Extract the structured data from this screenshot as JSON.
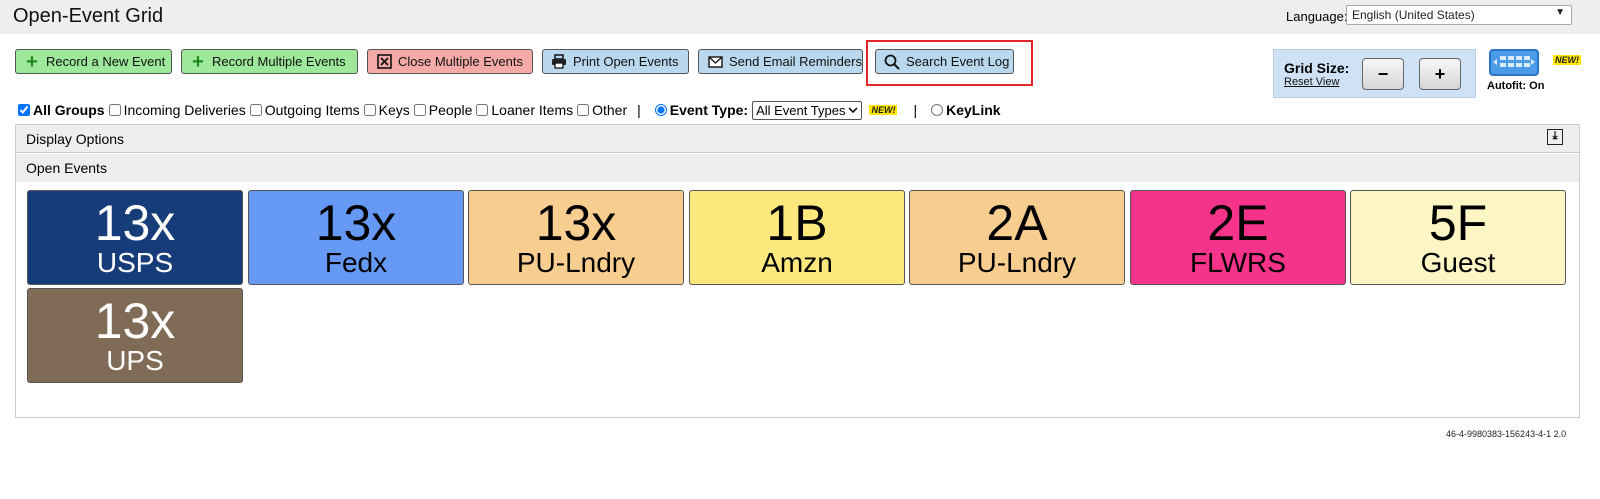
{
  "header": {
    "title": "Open-Event Grid",
    "language_label": "Language:",
    "language_value": "English (United States)"
  },
  "toolbar": {
    "record_new": "Record a New Event",
    "record_multiple": "Record Multiple Events",
    "close_multiple": "Close Multiple Events",
    "print_open": "Print Open Events",
    "send_email": "Send Email Reminders",
    "search_log": "Search Event Log"
  },
  "grid_size": {
    "label": "Grid Size:",
    "reset": "Reset View",
    "minus": "−",
    "plus": "+"
  },
  "autofit": {
    "label": "Autofit: On",
    "new_badge": "NEW!"
  },
  "filters": {
    "all_groups": "All Groups",
    "incoming": "Incoming Deliveries",
    "outgoing": "Outgoing Items",
    "keys": "Keys",
    "people": "People",
    "loaner": "Loaner Items",
    "other": "Other",
    "separator": "|",
    "event_type_label": "Event Type:",
    "event_type_value": "All Event Types",
    "new_badge": "NEW!",
    "keylink": "KeyLink"
  },
  "panels": {
    "display_options": "Display Options",
    "open_events": "Open Events"
  },
  "tiles": [
    {
      "big": "13x",
      "sub": "USPS",
      "bg": "#173c7a",
      "fg": "#ffffff"
    },
    {
      "big": "13x",
      "sub": "Fedx",
      "bg": "#6699f4",
      "fg": "#000000"
    },
    {
      "big": "13x",
      "sub": "PU-Lndry",
      "bg": "#f8cd90",
      "fg": "#000000"
    },
    {
      "big": "1B",
      "sub": "Amzn",
      "bg": "#fde87d",
      "fg": "#000000"
    },
    {
      "big": "2A",
      "sub": "PU-Lndry",
      "bg": "#f8cd90",
      "fg": "#000000"
    },
    {
      "big": "2E",
      "sub": "FLWRS",
      "bg": "#f5338a",
      "fg": "#000000"
    },
    {
      "big": "5F",
      "sub": "Guest",
      "bg": "#fdf5c4",
      "fg": "#000000"
    },
    {
      "big": "13x",
      "sub": "UPS",
      "bg": "#806b56",
      "fg": "#ffffff"
    }
  ],
  "footer": {
    "build_id": "46-4-9980383-156243-4-1 2.0"
  }
}
